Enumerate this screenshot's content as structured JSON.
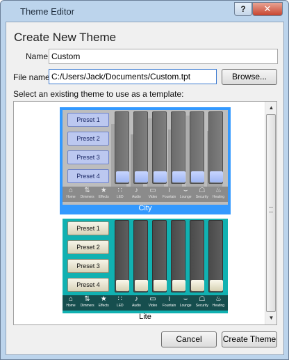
{
  "window": {
    "title": "Theme Editor",
    "help_label": "?",
    "close_label": "✕"
  },
  "dialog": {
    "heading": "Create New Theme",
    "name_label": "Name",
    "name_value": "Custom",
    "filename_label": "File name",
    "filename_value": "C:/Users/Jack/Documents/Custom.tpt",
    "browse_label": "Browse...",
    "template_prompt": "Select an existing theme to use as a template:",
    "cancel_label": "Cancel",
    "create_label": "Create Theme"
  },
  "themes": [
    {
      "name": "City",
      "selected": true
    },
    {
      "name": "Lite",
      "selected": false
    }
  ],
  "preview": {
    "presets": [
      "Preset 1",
      "Preset 2",
      "Preset 3",
      "Preset 4"
    ],
    "nav": [
      {
        "label": "Home",
        "icon": "home-icon",
        "glyph": "⌂"
      },
      {
        "label": "Dimmers",
        "icon": "dimmers-icon",
        "glyph": "⇅"
      },
      {
        "label": "Effects",
        "icon": "effects-icon",
        "glyph": "★"
      },
      {
        "label": "LED",
        "icon": "led-icon",
        "glyph": "∷"
      },
      {
        "label": "Audio",
        "icon": "audio-icon",
        "glyph": "♪"
      },
      {
        "label": "Video",
        "icon": "video-icon",
        "glyph": "▭"
      },
      {
        "label": "Fountain",
        "icon": "fountain-icon",
        "glyph": "≀"
      },
      {
        "label": "Lounge",
        "icon": "lounge-icon",
        "glyph": "⌣"
      },
      {
        "label": "Security",
        "icon": "security-icon",
        "glyph": "☖"
      },
      {
        "label": "Heating",
        "icon": "heating-icon",
        "glyph": "♨"
      }
    ]
  },
  "colors": {
    "selection": "#3399ff",
    "city_bg": "#b9b9b9",
    "lite_bg": "#0fb0b0",
    "lite_nav": "#164e4e"
  }
}
